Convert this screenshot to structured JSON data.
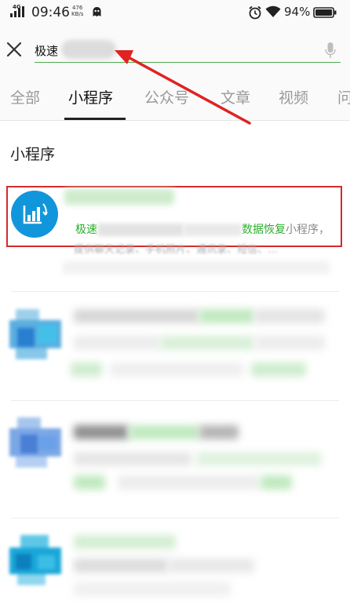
{
  "status_bar": {
    "network": "4G",
    "time": "09:46",
    "speed_value": "476",
    "speed_unit": "KB/s",
    "battery_percent": "94%"
  },
  "search": {
    "query": "极速"
  },
  "tabs": [
    {
      "label": "全部"
    },
    {
      "label": "小程序",
      "active": true
    },
    {
      "label": "公众号"
    },
    {
      "label": "文章"
    },
    {
      "label": "视频"
    },
    {
      "label": "问"
    }
  ],
  "results": {
    "section_title": "小程序",
    "first_item": {
      "desc_prefix": "极速",
      "desc_highlight": "数据恢复",
      "desc_suffix": "小程序，",
      "desc_line2": "提供聊天记录、手机照片、通讯录、短信、…"
    }
  },
  "colors": {
    "accent_green": "#2aae2a",
    "annotation_red": "#d62a2a",
    "logo_blue": "#1296db"
  }
}
